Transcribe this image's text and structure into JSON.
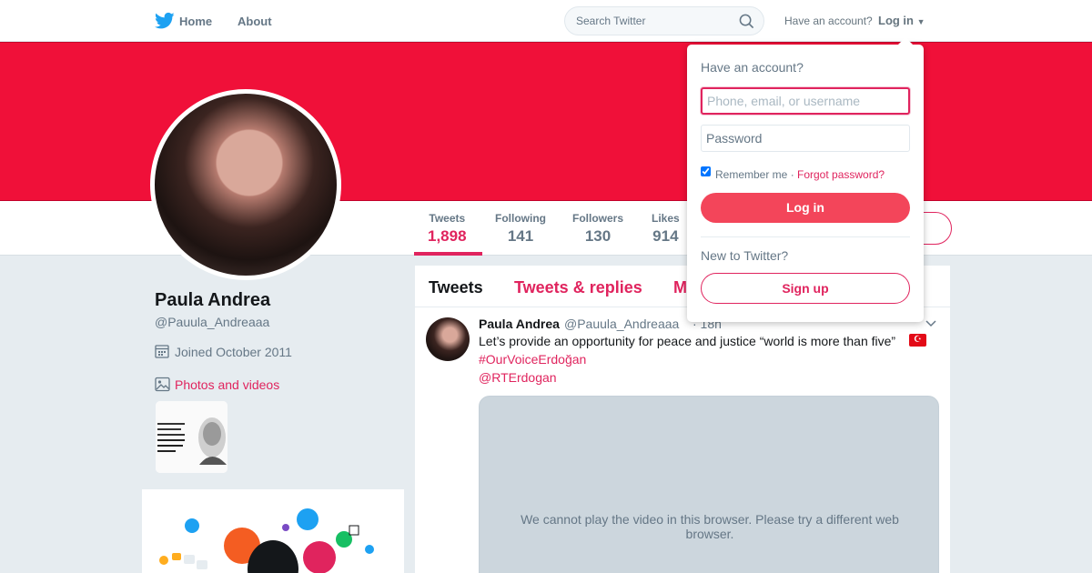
{
  "nav": {
    "home_label": "Home",
    "about_label": "About",
    "search_placeholder": "Search Twitter",
    "have_account": "Have an account?",
    "login_label": "Log in",
    "logo_icon": "twitter-bird-icon",
    "brand_color": "#1da1f2"
  },
  "banner": {
    "color": "#f01039"
  },
  "profile": {
    "name": "Paula Andrea",
    "handle": "@Pauula_Andreaaa",
    "joined": "Joined October 2011",
    "photos_label": "Photos and videos"
  },
  "stats": [
    {
      "label": "Tweets",
      "value": "1,898",
      "active": true
    },
    {
      "label": "Following",
      "value": "141"
    },
    {
      "label": "Followers",
      "value": "130"
    },
    {
      "label": "Likes",
      "value": "914"
    }
  ],
  "timeline": {
    "tabs": [
      "Tweets",
      "Tweets & replies",
      "M"
    ],
    "tweet": {
      "name": "Paula Andrea",
      "handle": "@Pauula_Andreaaa",
      "time": "· 18h",
      "text": "Let’s provide an opportunity for peace and justice “world is more than five”",
      "flag": "☪",
      "hashtag": "#OurVoiceErdoğan",
      "mention": "@RTErdogan",
      "video_message": "We cannot play the video in this browser. Please try a different web browser."
    }
  },
  "login_dropdown": {
    "title": "Have an account?",
    "username_placeholder": "Phone, email, or username",
    "password_placeholder": "Password",
    "remember_label": "Remember me ·",
    "forgot_label": "Forgot password?",
    "login_button": "Log in",
    "new_to": "New to Twitter?",
    "signup_button": "Sign up"
  },
  "accent_color": "#e0245e"
}
